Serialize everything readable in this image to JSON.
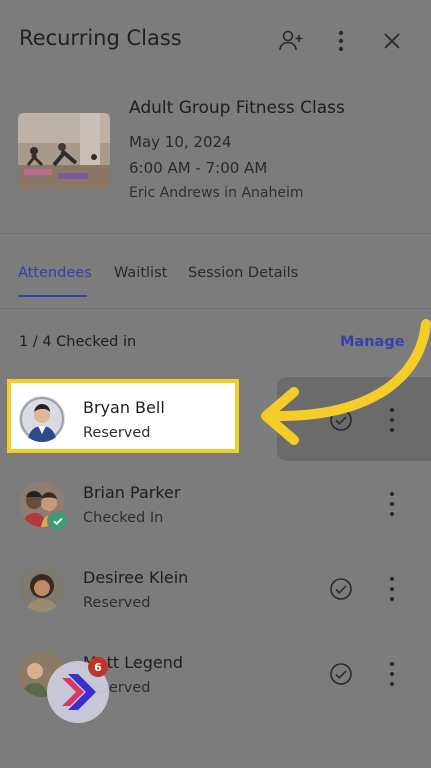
{
  "header": {
    "title": "Recurring Class"
  },
  "class": {
    "name": "Adult Group Fitness Class",
    "date": "May 10, 2024",
    "time": "6:00 AM - 7:00 AM",
    "instructor": "Eric Andrews in Anaheim"
  },
  "tabs": [
    {
      "label": "Attendees",
      "active": true
    },
    {
      "label": "Waitlist",
      "active": false
    },
    {
      "label": "Session Details",
      "active": false
    }
  ],
  "checkin": {
    "summary": "1 / 4 Checked in",
    "manage_label": "Manage"
  },
  "attendees": [
    {
      "name": "Bryan Bell",
      "status": "Reserved"
    },
    {
      "name": "Brian Parker",
      "status": "Checked In"
    },
    {
      "name": "Desiree Klein",
      "status": "Reserved"
    },
    {
      "name": "Matt Legend",
      "status": "Reserved"
    }
  ],
  "launcher": {
    "badge_count": "6"
  },
  "colors": {
    "accent": "#3b3fae",
    "highlight": "#f5cd2a",
    "badge": "#c0352b",
    "checked_in": "#3a9d7a"
  }
}
